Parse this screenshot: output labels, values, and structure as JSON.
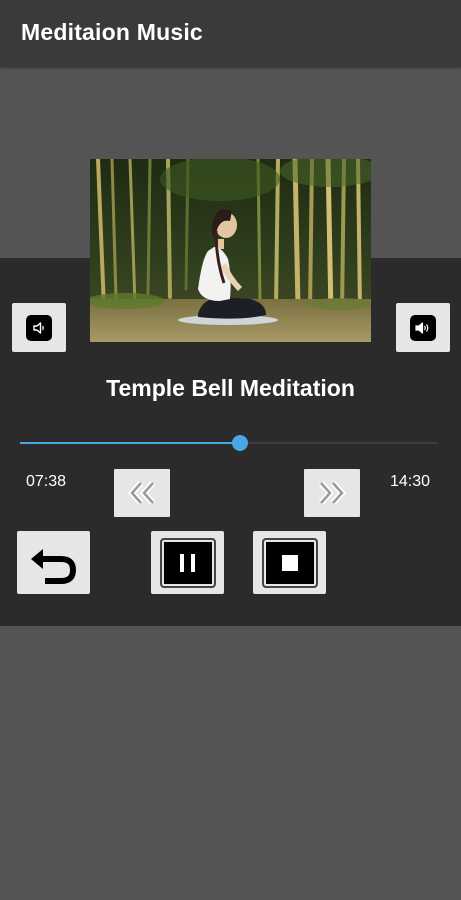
{
  "app": {
    "title": "Meditaion Music"
  },
  "track": {
    "title": "Temple Bell Meditation",
    "current_time": "07:38",
    "total_time": "14:30",
    "progress": 0.527
  },
  "colors": {
    "app_bar": "#3a3a3a",
    "background": "#545454",
    "panel": "#2b2b2b",
    "accent": "#4aa6e6",
    "button_face": "#e6e6e6"
  },
  "icons": {
    "volume_left": "volume-down-icon",
    "volume_right": "volume-up-icon",
    "rewind": "double-chevron-left-icon",
    "forward": "double-chevron-right-icon",
    "back": "undo-arrow-icon",
    "pause": "pause-icon",
    "stop": "stop-icon"
  }
}
